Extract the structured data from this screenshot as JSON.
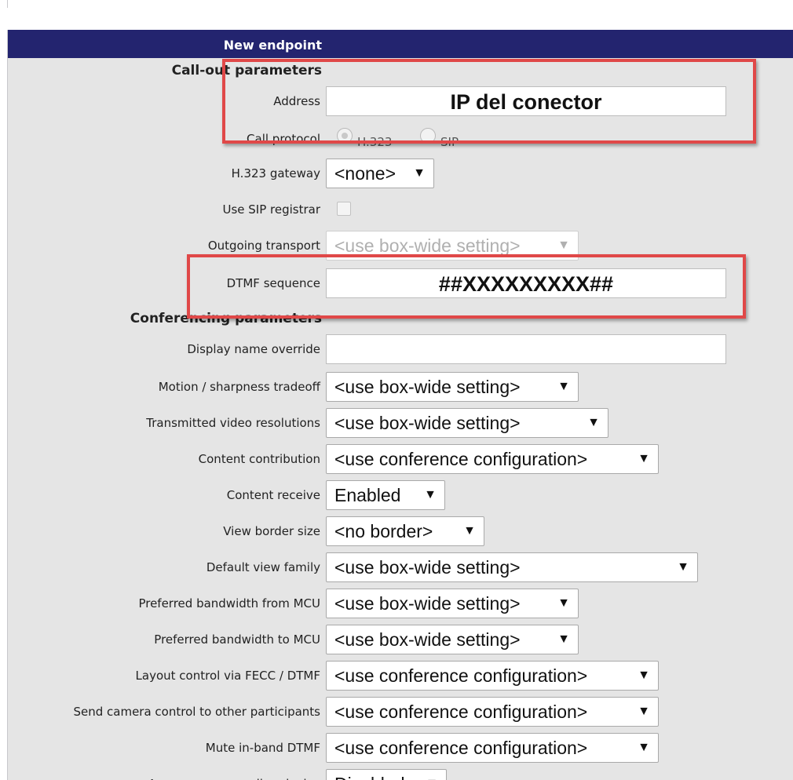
{
  "header": {
    "title": "New endpoint"
  },
  "sections": {
    "callout": "Call-out parameters",
    "conferencing": "Conferencing parameters"
  },
  "fields": {
    "address": {
      "label": "Address",
      "value": "IP del conector"
    },
    "call_protocol": {
      "label": "Call protocol",
      "options": [
        "H.323",
        "SIP"
      ],
      "selected": "H.323"
    },
    "h323_gateway": {
      "label": "H.323 gateway",
      "value": "<none>"
    },
    "use_sip_registrar": {
      "label": "Use SIP registrar",
      "checked": false
    },
    "outgoing_transport": {
      "label": "Outgoing transport",
      "value": "<use box-wide setting>"
    },
    "dtmf_sequence": {
      "label": "DTMF sequence",
      "value": "##XXXXXXXXX##"
    },
    "display_name_override": {
      "label": "Display name override",
      "value": ""
    },
    "motion_sharpness": {
      "label": "Motion / sharpness tradeoff",
      "value": "<use box-wide setting>"
    },
    "transmitted_video_res": {
      "label": "Transmitted video resolutions",
      "value": "<use box-wide setting>"
    },
    "content_contribution": {
      "label": "Content contribution",
      "value": "<use conference configuration>"
    },
    "content_receive": {
      "label": "Content receive",
      "value": "Enabled"
    },
    "view_border_size": {
      "label": "View border size",
      "value": "<no border>"
    },
    "default_view_family": {
      "label": "Default view family",
      "value": "<use box-wide setting>"
    },
    "bandwidth_from_mcu": {
      "label": "Preferred bandwidth from MCU",
      "value": "<use box-wide setting>"
    },
    "bandwidth_to_mcu": {
      "label": "Preferred bandwidth to MCU",
      "value": "<use box-wide setting>"
    },
    "layout_control": {
      "label": "Layout control via FECC / DTMF",
      "value": "<use conference configuration>"
    },
    "far_end_camera": {
      "label": "Send camera control to other participants",
      "value": "<use conference configuration>"
    },
    "mute_inband_dtmf": {
      "label": "Mute in-band DTMF",
      "value": "<use conference configuration>"
    },
    "partial_row": {
      "label": "Appear as a recording device",
      "value": "Disabled"
    }
  },
  "colors": {
    "header_bg": "#23246f",
    "panel_bg": "#e5e5e5",
    "highlight": "#e04848"
  }
}
